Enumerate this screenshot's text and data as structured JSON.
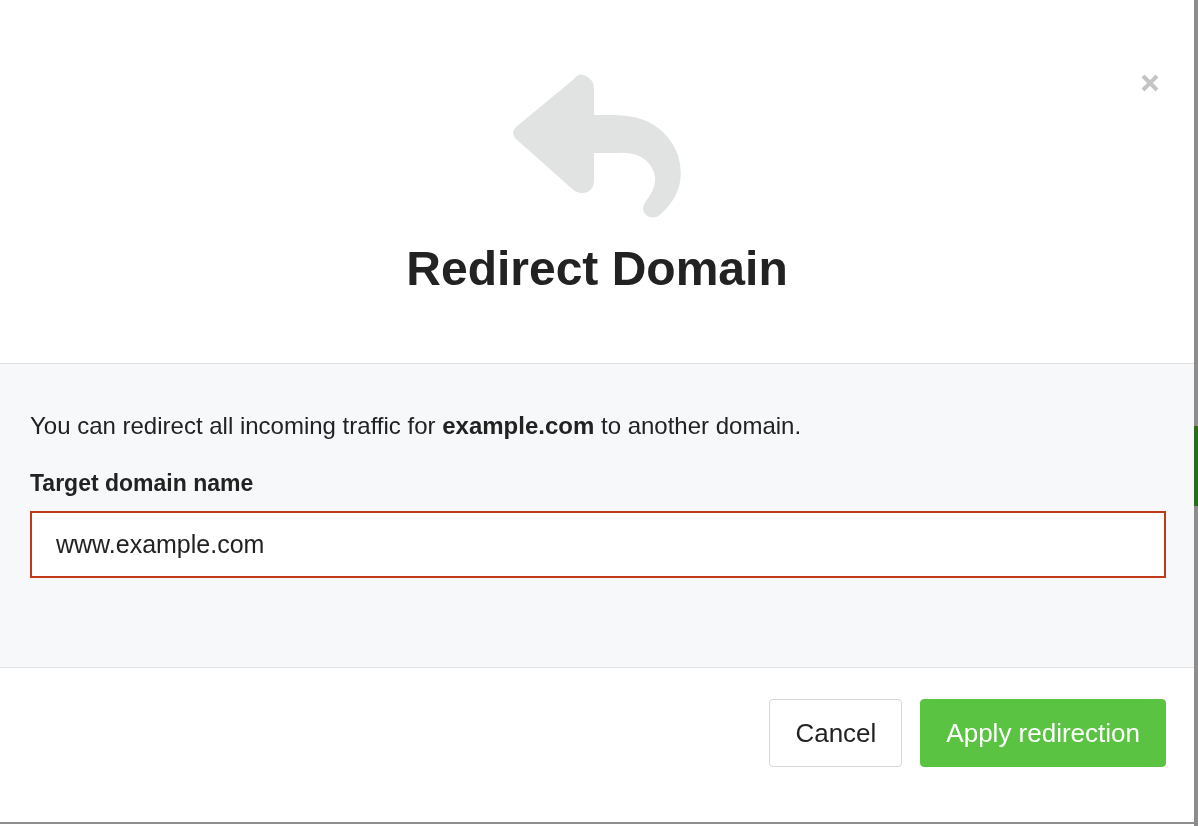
{
  "dialog": {
    "title": "Redirect Domain",
    "description": "You can redirect all incoming traffic for **example.com** to another domain.",
    "field": {
      "label": "Target domain name",
      "value": "www.example.com",
      "invalid": true
    },
    "buttons": [
      {
        "label": "Cancel",
        "kind": "secondary"
      },
      {
        "label": "Apply redirection",
        "kind": "primary"
      }
    ]
  }
}
